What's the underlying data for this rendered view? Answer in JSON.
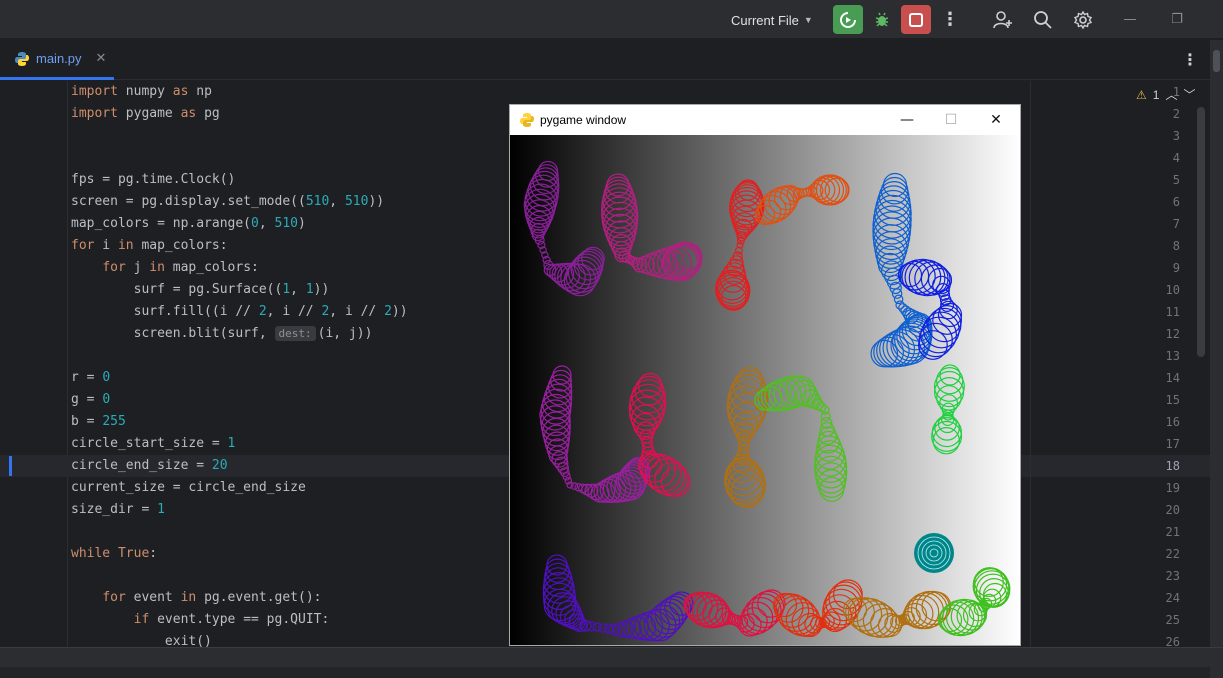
{
  "toolbar": {
    "run_config": "Current File",
    "window_controls": [
      "—",
      "❐"
    ]
  },
  "tab": {
    "label": "main.py"
  },
  "inspections": {
    "warning_count": "1"
  },
  "editor": {
    "current_line": 18,
    "lines": [
      {
        "n": "1",
        "code": "import numpy as np"
      },
      {
        "n": "2",
        "code": "import pygame as pg"
      },
      {
        "n": "3",
        "code": ""
      },
      {
        "n": "4",
        "code": ""
      },
      {
        "n": "5",
        "code": "fps = pg.time.Clock()"
      },
      {
        "n": "6",
        "code": "screen = pg.display.set_mode((510, 510))"
      },
      {
        "n": "7",
        "code": "map_colors = np.arange(0, 510)"
      },
      {
        "n": "8",
        "code": "for i in map_colors:"
      },
      {
        "n": "9",
        "code": "    for j in map_colors:"
      },
      {
        "n": "10",
        "code": "        surf = pg.Surface((1, 1))"
      },
      {
        "n": "11",
        "code": "        surf.fill((i // 2, i // 2, i // 2))"
      },
      {
        "n": "12",
        "code": "        screen.blit(surf, (i, j))",
        "hint": "dest:"
      },
      {
        "n": "13",
        "code": ""
      },
      {
        "n": "14",
        "code": "r = 0"
      },
      {
        "n": "15",
        "code": "g = 0"
      },
      {
        "n": "16",
        "code": "b = 255"
      },
      {
        "n": "17",
        "code": "circle_start_size = 1"
      },
      {
        "n": "18",
        "code": "circle_end_size = 20"
      },
      {
        "n": "19",
        "code": "current_size = circle_end_size"
      },
      {
        "n": "20",
        "code": "size_dir = 1"
      },
      {
        "n": "21",
        "code": ""
      },
      {
        "n": "22",
        "code": "while True:"
      },
      {
        "n": "23",
        "code": ""
      },
      {
        "n": "24",
        "code": "    for event in pg.event.get():"
      },
      {
        "n": "25",
        "code": "        if event.type == pg.QUIT:"
      },
      {
        "n": "26",
        "code": "            exit()"
      }
    ]
  },
  "pygame_window": {
    "title": "pygame window",
    "controls": [
      "—",
      "☐",
      "✕"
    ]
  },
  "colors": {
    "keyword": "#cf8e6d",
    "number": "#2aacb8",
    "run_green": "#499c54",
    "stop_red": "#c94f4f",
    "accent_blue": "#3574f0"
  }
}
